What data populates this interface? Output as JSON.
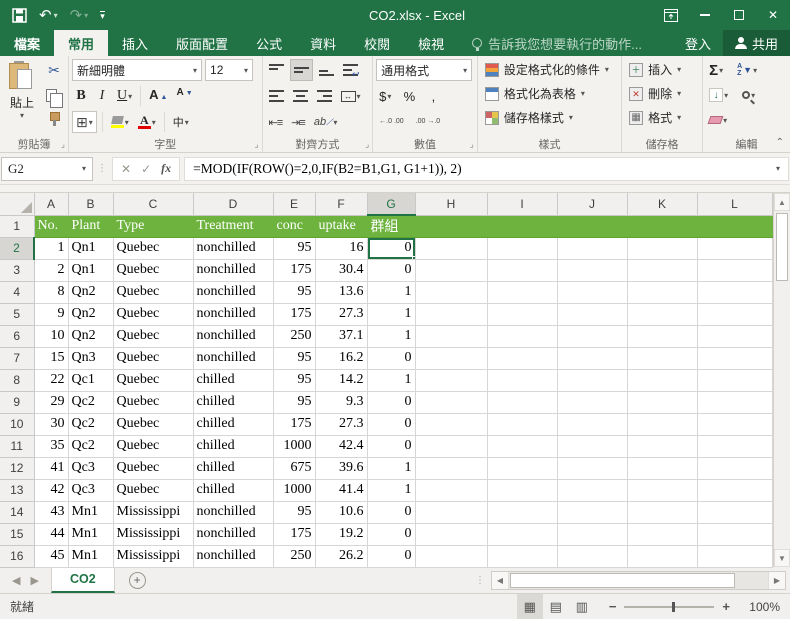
{
  "titlebar": {
    "title": "CO2.xlsx - Excel"
  },
  "tabs": {
    "file": "檔案",
    "items": [
      "常用",
      "插入",
      "版面配置",
      "公式",
      "資料",
      "校閱",
      "檢視"
    ],
    "active": "常用",
    "tellme": "告訴我您想要執行的動作...",
    "signin": "登入",
    "share": "共用"
  },
  "ribbon": {
    "paste_label": "貼上",
    "font_name": "新細明體",
    "font_size": "12",
    "number_format": "通用格式",
    "groups": {
      "clipboard": "剪貼簿",
      "font": "字型",
      "alignment": "對齊方式",
      "number": "數值",
      "styles": "樣式",
      "cells": "儲存格",
      "editing": "編輯"
    },
    "styles_buttons": [
      "設定格式化的條件",
      "格式化為表格",
      "儲存格樣式"
    ],
    "cells_buttons": [
      "插入",
      "刪除",
      "格式"
    ],
    "glyphs": {
      "bold": "B",
      "italic": "I",
      "underline": "U",
      "grow_font": "A",
      "shrink_font": "A",
      "border": "⊞",
      "phonetic": "中",
      "currency": "$",
      "percent": "%",
      "comma": ",",
      "inc_decimal": "←.0 .00",
      "dec_decimal": ".00 →.0",
      "autosum": "Σ",
      "sort_a": "A",
      "sort_z": "Z",
      "fill": "↓",
      "indent_dec": "⇤≡",
      "indent_inc": "⇥≡",
      "orientation": "ab",
      "merge_arrows": "↔"
    }
  },
  "formula_bar": {
    "name_box": "G2",
    "cancel": "✕",
    "enter": "✓",
    "fx": "fx",
    "formula": "=MOD(IF(ROW()=2,0,IF(B2=B1,G1, G1+1)), 2)"
  },
  "sheet": {
    "columns": [
      "A",
      "B",
      "C",
      "D",
      "E",
      "F",
      "G",
      "H",
      "I",
      "J",
      "K",
      "L"
    ],
    "selected_column": "G",
    "selected_row": 2,
    "active_cell": "G2",
    "header_row": [
      "No.",
      "Plant",
      "Type",
      "Treatment",
      "conc",
      "uptake",
      "群組"
    ],
    "rows": [
      [
        1,
        "Qn1",
        "Quebec",
        "nonchilled",
        95,
        16,
        0
      ],
      [
        2,
        "Qn1",
        "Quebec",
        "nonchilled",
        175,
        30.4,
        0
      ],
      [
        8,
        "Qn2",
        "Quebec",
        "nonchilled",
        95,
        13.6,
        1
      ],
      [
        9,
        "Qn2",
        "Quebec",
        "nonchilled",
        175,
        27.3,
        1
      ],
      [
        10,
        "Qn2",
        "Quebec",
        "nonchilled",
        250,
        37.1,
        1
      ],
      [
        15,
        "Qn3",
        "Quebec",
        "nonchilled",
        95,
        16.2,
        0
      ],
      [
        22,
        "Qc1",
        "Quebec",
        "chilled",
        95,
        14.2,
        1
      ],
      [
        29,
        "Qc2",
        "Quebec",
        "chilled",
        95,
        9.3,
        0
      ],
      [
        30,
        "Qc2",
        "Quebec",
        "chilled",
        175,
        27.3,
        0
      ],
      [
        35,
        "Qc2",
        "Quebec",
        "chilled",
        1000,
        42.4,
        0
      ],
      [
        41,
        "Qc3",
        "Quebec",
        "chilled",
        675,
        39.6,
        1
      ],
      [
        42,
        "Qc3",
        "Quebec",
        "chilled",
        1000,
        41.4,
        1
      ],
      [
        43,
        "Mn1",
        "Mississippi",
        "nonchilled",
        95,
        10.6,
        0
      ],
      [
        44,
        "Mn1",
        "Mississippi",
        "nonchilled",
        175,
        19.2,
        0
      ],
      [
        45,
        "Mn1",
        "Mississippi",
        "nonchilled",
        250,
        26.2,
        0
      ]
    ]
  },
  "sheet_tabs": {
    "active": "CO2",
    "add": "+"
  },
  "status_bar": {
    "ready": "就緒",
    "zoom": "100%"
  },
  "colors": {
    "accent": "#217346",
    "header_fill": "#6db33e",
    "highlight_yellow": "#ffff00",
    "font_red": "#e00000"
  }
}
